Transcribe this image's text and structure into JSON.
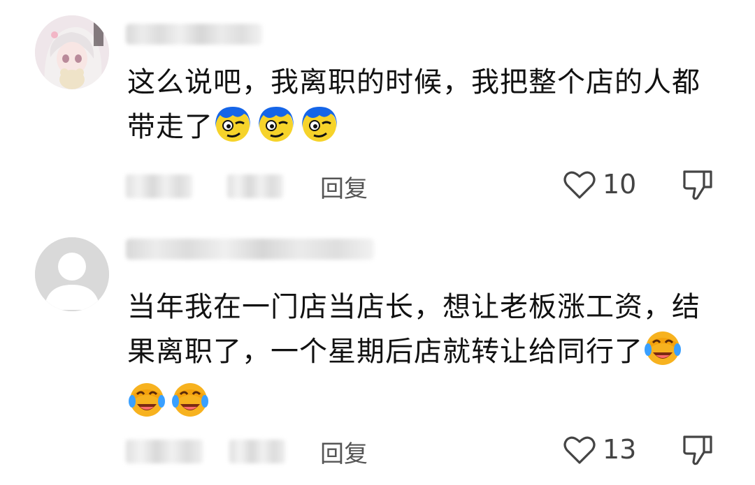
{
  "comments": [
    {
      "text": "这么说吧，我离职的时候，我把整个店的人都带走了",
      "emojis": [
        "smirk-emoji",
        "smirk-emoji",
        "smirk-emoji"
      ],
      "reply_label": "回复",
      "likes": "10"
    },
    {
      "text": "当年我在一门店当店长，想让老板涨工资，结果离职了，一个星期后店就转让给同行了",
      "emojis": [
        "facepalm-laugh-emoji",
        "facepalm-laugh-emoji",
        "facepalm-laugh-emoji"
      ],
      "reply_label": "回复",
      "likes": "13"
    }
  ],
  "colors": {
    "text": "#111111",
    "secondary": "#555555",
    "icon": "#444444",
    "smirk_hair": "#1565e8",
    "smirk_face": "#f6d32a",
    "laugh_face": "#f7b21f",
    "laugh_tears": "#3aa0ff"
  }
}
